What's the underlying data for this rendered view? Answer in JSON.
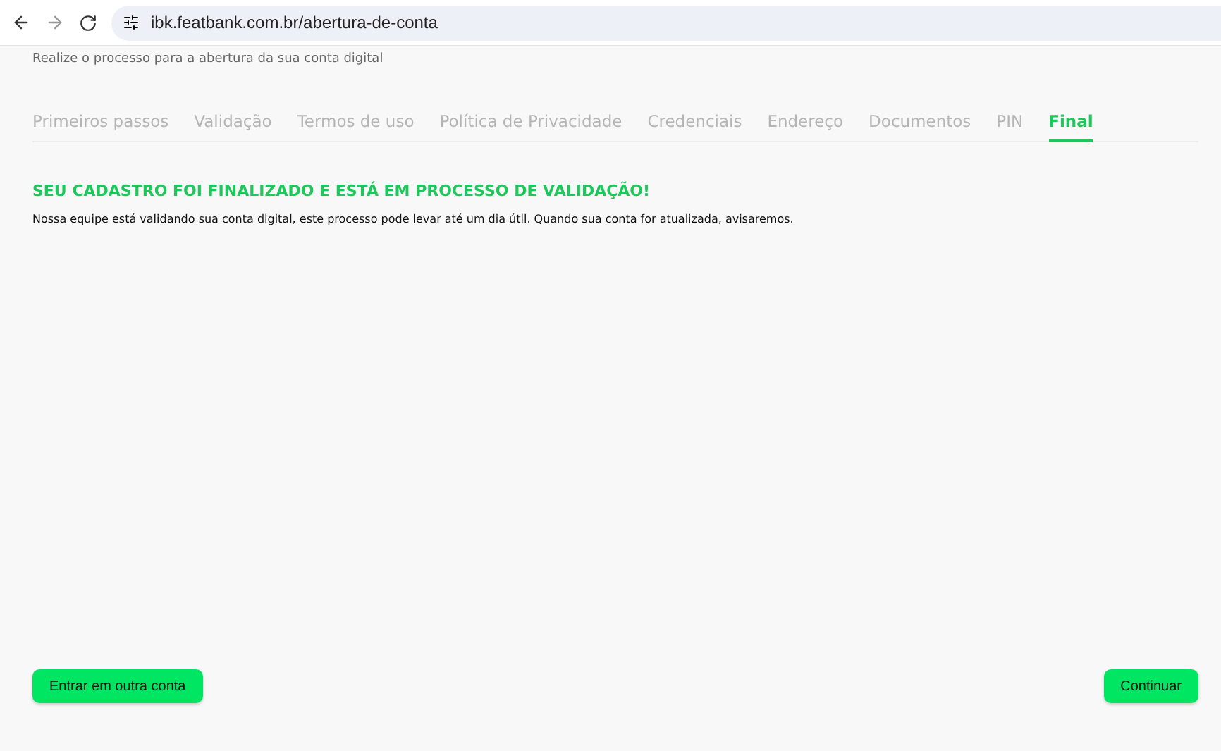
{
  "browser": {
    "url": "ibk.featbank.com.br/abertura-de-conta"
  },
  "subtitle": "Realize o processo para a abertura da sua conta digital",
  "tabs": [
    {
      "label": "Primeiros passos",
      "selected": false
    },
    {
      "label": "Validação",
      "selected": false
    },
    {
      "label": "Termos de uso",
      "selected": false
    },
    {
      "label": "Política de Privacidade",
      "selected": false
    },
    {
      "label": "Credenciais",
      "selected": false
    },
    {
      "label": "Endereço",
      "selected": false
    },
    {
      "label": "Documentos",
      "selected": false
    },
    {
      "label": "PIN",
      "selected": false
    },
    {
      "label": "Final",
      "selected": true
    }
  ],
  "heading": "SEU CADASTRO FOI FINALIZADO E ESTÁ EM PROCESSO DE VALIDAÇÃO!",
  "message": "Nossa equipe está validando sua conta digital, este processo pode levar até um dia útil. Quando sua conta for atualizada, avisaremos.",
  "buttons": [
    "Entrar em outra conta",
    "Continuar"
  ]
}
